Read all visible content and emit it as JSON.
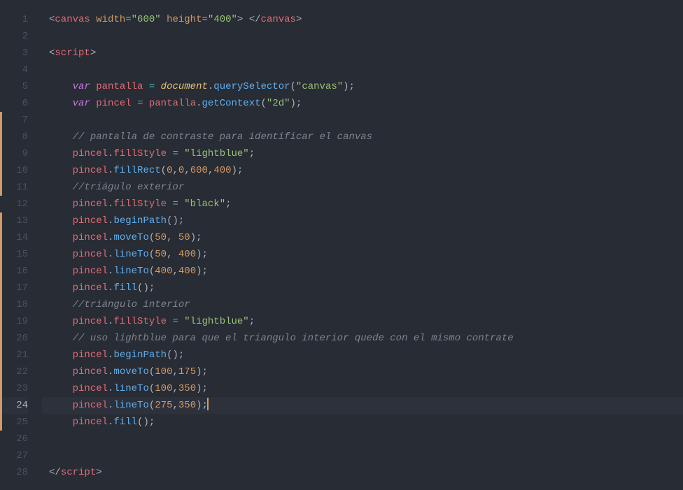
{
  "lineCount": 28,
  "currentLine": 24,
  "modifiedRanges": [
    [
      7,
      11
    ],
    [
      13,
      25
    ]
  ],
  "lines": {
    "1": [
      {
        "c": "tok-punc",
        "t": "<"
      },
      {
        "c": "tok-tag",
        "t": "canvas"
      },
      {
        "c": "tok-plain",
        "t": " "
      },
      {
        "c": "tok-attr",
        "t": "width"
      },
      {
        "c": "tok-punc",
        "t": "="
      },
      {
        "c": "tok-string",
        "t": "\"600\""
      },
      {
        "c": "tok-plain",
        "t": " "
      },
      {
        "c": "tok-attr",
        "t": "height"
      },
      {
        "c": "tok-punc",
        "t": "="
      },
      {
        "c": "tok-string",
        "t": "\"400\""
      },
      {
        "c": "tok-punc",
        "t": ">"
      },
      {
        "c": "tok-plain",
        "t": " "
      },
      {
        "c": "tok-punc",
        "t": "</"
      },
      {
        "c": "tok-tag",
        "t": "canvas"
      },
      {
        "c": "tok-punc",
        "t": ">"
      }
    ],
    "2": [],
    "3": [
      {
        "c": "tok-punc",
        "t": "<"
      },
      {
        "c": "tok-tag",
        "t": "script"
      },
      {
        "c": "tok-punc",
        "t": ">"
      }
    ],
    "4": [],
    "5": [
      {
        "c": "tok-plain",
        "t": "    "
      },
      {
        "c": "tok-keyword",
        "t": "var"
      },
      {
        "c": "tok-plain",
        "t": " "
      },
      {
        "c": "tok-var",
        "t": "pantalla"
      },
      {
        "c": "tok-plain",
        "t": " "
      },
      {
        "c": "tok-op",
        "t": "="
      },
      {
        "c": "tok-plain",
        "t": " "
      },
      {
        "c": "tok-builtin",
        "t": "document"
      },
      {
        "c": "tok-punc",
        "t": "."
      },
      {
        "c": "tok-func",
        "t": "querySelector"
      },
      {
        "c": "tok-punc",
        "t": "("
      },
      {
        "c": "tok-string",
        "t": "\"canvas\""
      },
      {
        "c": "tok-punc",
        "t": ");"
      }
    ],
    "6": [
      {
        "c": "tok-plain",
        "t": "    "
      },
      {
        "c": "tok-keyword",
        "t": "var"
      },
      {
        "c": "tok-plain",
        "t": " "
      },
      {
        "c": "tok-var",
        "t": "pincel"
      },
      {
        "c": "tok-plain",
        "t": " "
      },
      {
        "c": "tok-op",
        "t": "="
      },
      {
        "c": "tok-plain",
        "t": " "
      },
      {
        "c": "tok-var",
        "t": "pantalla"
      },
      {
        "c": "tok-punc",
        "t": "."
      },
      {
        "c": "tok-func",
        "t": "getContext"
      },
      {
        "c": "tok-punc",
        "t": "("
      },
      {
        "c": "tok-string",
        "t": "\"2d\""
      },
      {
        "c": "tok-punc",
        "t": ");"
      }
    ],
    "7": [],
    "8": [
      {
        "c": "tok-plain",
        "t": "    "
      },
      {
        "c": "tok-comment",
        "t": "// pantalla de contraste para identificar el canvas"
      }
    ],
    "9": [
      {
        "c": "tok-plain",
        "t": "    "
      },
      {
        "c": "tok-var",
        "t": "pincel"
      },
      {
        "c": "tok-punc",
        "t": "."
      },
      {
        "c": "tok-var",
        "t": "fillStyle"
      },
      {
        "c": "tok-plain",
        "t": " "
      },
      {
        "c": "tok-op",
        "t": "="
      },
      {
        "c": "tok-plain",
        "t": " "
      },
      {
        "c": "tok-string",
        "t": "\"lightblue\""
      },
      {
        "c": "tok-punc",
        "t": ";"
      }
    ],
    "10": [
      {
        "c": "tok-plain",
        "t": "    "
      },
      {
        "c": "tok-var",
        "t": "pincel"
      },
      {
        "c": "tok-punc",
        "t": "."
      },
      {
        "c": "tok-func",
        "t": "fillRect"
      },
      {
        "c": "tok-punc",
        "t": "("
      },
      {
        "c": "tok-number",
        "t": "0"
      },
      {
        "c": "tok-punc",
        "t": ","
      },
      {
        "c": "tok-number",
        "t": "0"
      },
      {
        "c": "tok-punc",
        "t": ","
      },
      {
        "c": "tok-number",
        "t": "600"
      },
      {
        "c": "tok-punc",
        "t": ","
      },
      {
        "c": "tok-number",
        "t": "400"
      },
      {
        "c": "tok-punc",
        "t": ");"
      }
    ],
    "11": [
      {
        "c": "tok-plain",
        "t": "    "
      },
      {
        "c": "tok-comment",
        "t": "//triágulo exterior"
      }
    ],
    "12": [
      {
        "c": "tok-plain",
        "t": "    "
      },
      {
        "c": "tok-var",
        "t": "pincel"
      },
      {
        "c": "tok-punc",
        "t": "."
      },
      {
        "c": "tok-var",
        "t": "fillStyle"
      },
      {
        "c": "tok-plain",
        "t": " "
      },
      {
        "c": "tok-op",
        "t": "="
      },
      {
        "c": "tok-plain",
        "t": " "
      },
      {
        "c": "tok-string",
        "t": "\"black\""
      },
      {
        "c": "tok-punc",
        "t": ";"
      }
    ],
    "13": [
      {
        "c": "tok-plain",
        "t": "    "
      },
      {
        "c": "tok-var",
        "t": "pincel"
      },
      {
        "c": "tok-punc",
        "t": "."
      },
      {
        "c": "tok-func",
        "t": "beginPath"
      },
      {
        "c": "tok-punc",
        "t": "();"
      }
    ],
    "14": [
      {
        "c": "tok-plain",
        "t": "    "
      },
      {
        "c": "tok-var",
        "t": "pincel"
      },
      {
        "c": "tok-punc",
        "t": "."
      },
      {
        "c": "tok-func",
        "t": "moveTo"
      },
      {
        "c": "tok-punc",
        "t": "("
      },
      {
        "c": "tok-number",
        "t": "50"
      },
      {
        "c": "tok-punc",
        "t": ", "
      },
      {
        "c": "tok-number",
        "t": "50"
      },
      {
        "c": "tok-punc",
        "t": ");"
      }
    ],
    "15": [
      {
        "c": "tok-plain",
        "t": "    "
      },
      {
        "c": "tok-var",
        "t": "pincel"
      },
      {
        "c": "tok-punc",
        "t": "."
      },
      {
        "c": "tok-func",
        "t": "lineTo"
      },
      {
        "c": "tok-punc",
        "t": "("
      },
      {
        "c": "tok-number",
        "t": "50"
      },
      {
        "c": "tok-punc",
        "t": ", "
      },
      {
        "c": "tok-number",
        "t": "400"
      },
      {
        "c": "tok-punc",
        "t": ");"
      }
    ],
    "16": [
      {
        "c": "tok-plain",
        "t": "    "
      },
      {
        "c": "tok-var",
        "t": "pincel"
      },
      {
        "c": "tok-punc",
        "t": "."
      },
      {
        "c": "tok-func",
        "t": "lineTo"
      },
      {
        "c": "tok-punc",
        "t": "("
      },
      {
        "c": "tok-number",
        "t": "400"
      },
      {
        "c": "tok-punc",
        "t": ","
      },
      {
        "c": "tok-number",
        "t": "400"
      },
      {
        "c": "tok-punc",
        "t": ");"
      }
    ],
    "17": [
      {
        "c": "tok-plain",
        "t": "    "
      },
      {
        "c": "tok-var",
        "t": "pincel"
      },
      {
        "c": "tok-punc",
        "t": "."
      },
      {
        "c": "tok-func",
        "t": "fill"
      },
      {
        "c": "tok-punc",
        "t": "();"
      }
    ],
    "18": [
      {
        "c": "tok-plain",
        "t": "    "
      },
      {
        "c": "tok-comment",
        "t": "//triángulo interior"
      }
    ],
    "19": [
      {
        "c": "tok-plain",
        "t": "    "
      },
      {
        "c": "tok-var",
        "t": "pincel"
      },
      {
        "c": "tok-punc",
        "t": "."
      },
      {
        "c": "tok-var",
        "t": "fillStyle"
      },
      {
        "c": "tok-plain",
        "t": " "
      },
      {
        "c": "tok-op",
        "t": "="
      },
      {
        "c": "tok-plain",
        "t": " "
      },
      {
        "c": "tok-string",
        "t": "\"lightblue\""
      },
      {
        "c": "tok-punc",
        "t": ";"
      }
    ],
    "20": [
      {
        "c": "tok-plain",
        "t": "    "
      },
      {
        "c": "tok-comment",
        "t": "// uso lightblue para que el triangulo interior quede con el mismo contrate "
      }
    ],
    "21": [
      {
        "c": "tok-plain",
        "t": "    "
      },
      {
        "c": "tok-var",
        "t": "pincel"
      },
      {
        "c": "tok-punc",
        "t": "."
      },
      {
        "c": "tok-func",
        "t": "beginPath"
      },
      {
        "c": "tok-punc",
        "t": "();"
      }
    ],
    "22": [
      {
        "c": "tok-plain",
        "t": "    "
      },
      {
        "c": "tok-var",
        "t": "pincel"
      },
      {
        "c": "tok-punc",
        "t": "."
      },
      {
        "c": "tok-func",
        "t": "moveTo"
      },
      {
        "c": "tok-punc",
        "t": "("
      },
      {
        "c": "tok-number",
        "t": "100"
      },
      {
        "c": "tok-punc",
        "t": ","
      },
      {
        "c": "tok-number",
        "t": "175"
      },
      {
        "c": "tok-punc",
        "t": ");"
      }
    ],
    "23": [
      {
        "c": "tok-plain",
        "t": "    "
      },
      {
        "c": "tok-var",
        "t": "pincel"
      },
      {
        "c": "tok-punc",
        "t": "."
      },
      {
        "c": "tok-func",
        "t": "lineTo"
      },
      {
        "c": "tok-punc",
        "t": "("
      },
      {
        "c": "tok-number",
        "t": "100"
      },
      {
        "c": "tok-punc",
        "t": ","
      },
      {
        "c": "tok-number",
        "t": "350"
      },
      {
        "c": "tok-punc",
        "t": ");"
      }
    ],
    "24": [
      {
        "c": "tok-plain",
        "t": "    "
      },
      {
        "c": "tok-var",
        "t": "pincel"
      },
      {
        "c": "tok-punc",
        "t": "."
      },
      {
        "c": "tok-func",
        "t": "lineTo"
      },
      {
        "c": "tok-punc",
        "t": "("
      },
      {
        "c": "tok-number",
        "t": "275"
      },
      {
        "c": "tok-punc",
        "t": ","
      },
      {
        "c": "tok-number",
        "t": "350"
      },
      {
        "c": "tok-punc",
        "t": ");"
      }
    ],
    "25": [
      {
        "c": "tok-plain",
        "t": "    "
      },
      {
        "c": "tok-var",
        "t": "pincel"
      },
      {
        "c": "tok-punc",
        "t": "."
      },
      {
        "c": "tok-func",
        "t": "fill"
      },
      {
        "c": "tok-punc",
        "t": "();"
      }
    ],
    "26": [],
    "27": [],
    "28": [
      {
        "c": "tok-punc",
        "t": "</"
      },
      {
        "c": "tok-tag",
        "t": "script"
      },
      {
        "c": "tok-punc",
        "t": ">"
      }
    ]
  }
}
